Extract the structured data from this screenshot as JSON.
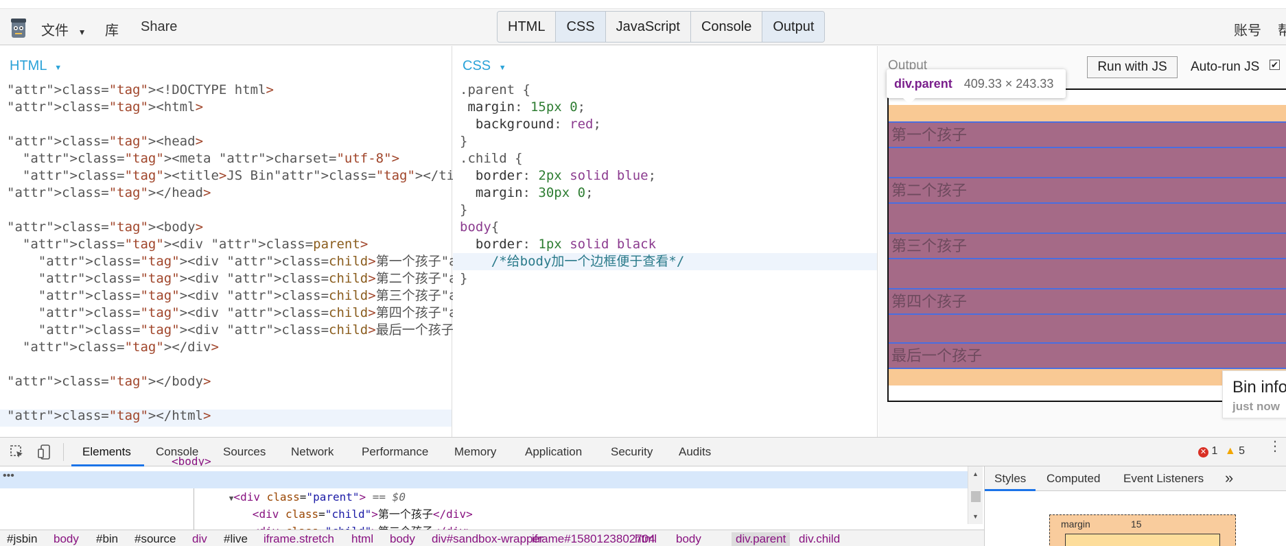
{
  "topbar": {
    "menu_file": "文件",
    "menu_library": "库",
    "menu_share": "Share",
    "tabs": [
      {
        "label": "HTML",
        "active": false
      },
      {
        "label": "CSS",
        "active": true
      },
      {
        "label": "JavaScript",
        "active": false
      },
      {
        "label": "Console",
        "active": false
      },
      {
        "label": "Output",
        "active": true
      }
    ],
    "account": "账号",
    "help": "帮"
  },
  "html_panel": {
    "label": "HTML",
    "lines": [
      "<!DOCTYPE html>",
      "<html>",
      "",
      "<head>",
      "  <meta charset=\"utf-8\">",
      "  <title>JS Bin</title>",
      "</head>",
      "",
      "<body>",
      "  <div class=parent>",
      "    <div class=child>第一个孩子</div>",
      "    <div class=child>第二个孩子</div>",
      "    <div class=child>第三个孩子</div>",
      "    <div class=child>第四个孩子</div>",
      "    <div class=child>最后一个孩子</div>",
      "  </div>",
      "",
      "</body>",
      "",
      "</html>"
    ]
  },
  "css_panel": {
    "label": "CSS",
    "lines": [
      ".parent {",
      " margin: 15px 0;",
      "  background: red;",
      "}",
      ".child {",
      "  border: 2px solid blue;",
      "  margin: 30px 0;",
      "}",
      "body{",
      "  border: 1px solid black",
      "    /*给body加一个边框便于查看*/",
      "}"
    ]
  },
  "output_panel": {
    "title": "Output",
    "run_button": "Run with JS",
    "autorun_label": "Auto-run JS",
    "autorun_checked": true,
    "children": [
      "第一个孩子",
      "第二个孩子",
      "第三个孩子",
      "第四个孩子",
      "最后一个孩子"
    ],
    "tooltip_selector": "div.parent",
    "tooltip_dims": "409.33 × 243.33",
    "bin_info_title": "Bin info",
    "bin_info_sub": "just now",
    "colors": {
      "margin": "#f9c994",
      "content": "#a56a87",
      "child_border": "#4a6ee0"
    }
  },
  "devtools": {
    "tabs": [
      "Elements",
      "Console",
      "Sources",
      "Network",
      "Performance",
      "Memory",
      "Application",
      "Security",
      "Audits"
    ],
    "active_tab": "Elements",
    "errors": "1",
    "warnings": "5",
    "elements": {
      "prev_line": "<body>",
      "selected": {
        "tag": "div",
        "attr": "class",
        "value": "parent",
        "suffix": "== $0"
      },
      "children": [
        {
          "tag": "div",
          "attr": "class",
          "value": "child",
          "text": "第一个孩子"
        },
        {
          "tag": "div",
          "attr": "class",
          "value": "child",
          "text": "第二个孩子"
        }
      ]
    },
    "styles_tabs": [
      "Styles",
      "Computed",
      "Event Listeners"
    ],
    "more_tabs": "»",
    "box_model": {
      "label": "margin",
      "value": "15"
    },
    "breadcrumb": [
      "#jsbin",
      "body",
      "#bin",
      "#source",
      "div",
      "#live",
      "iframe.stretch",
      "html",
      "body",
      "div#sandbox-wrapper",
      "iframe#1580123802704",
      "html",
      "body",
      "div.parent",
      "div.child"
    ]
  }
}
